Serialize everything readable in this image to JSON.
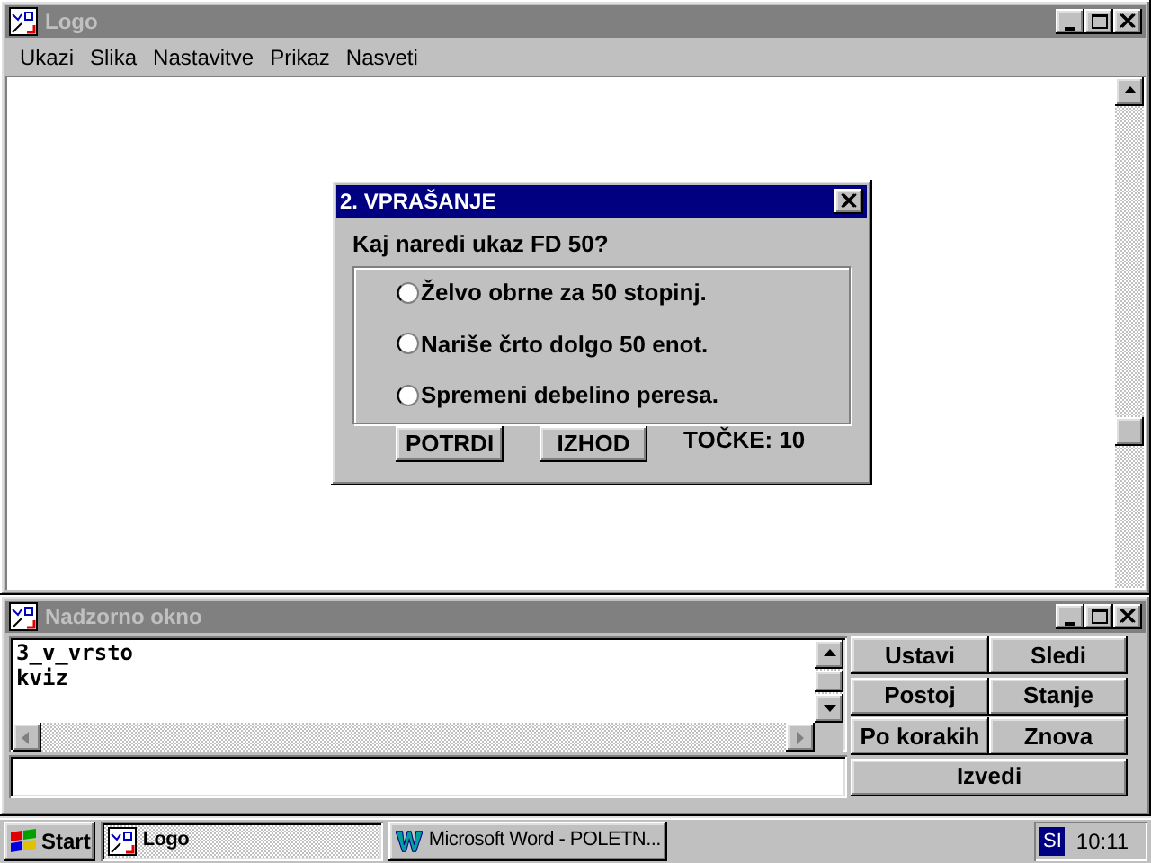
{
  "main_window": {
    "title": "Logo",
    "active": false,
    "menu": [
      "Ukazi",
      "Slika",
      "Nastavitve",
      "Prikaz",
      "Nasveti"
    ]
  },
  "dialog": {
    "title": "2. VPRAŠANJE",
    "active": true,
    "question": "Kaj naredi ukaz FD 50?",
    "options": [
      {
        "label": "Želvo obrne za 50 stopinj.",
        "selected": false
      },
      {
        "label": "Nariše črto dolgo 50 enot.",
        "selected": false
      },
      {
        "label": "Spremeni debelino peresa.",
        "selected": false
      }
    ],
    "buttons": [
      "POTRDI",
      "IZHOD"
    ],
    "score": "TOČKE: 10"
  },
  "monitor_window": {
    "title": "Nadzorno okno",
    "active": false,
    "lines": [
      "3_v_vrsto",
      "kviz"
    ],
    "buttons": [
      "Ustavi",
      "Sledi",
      "Postoj",
      "Stanje",
      "Po korakih",
      "Znova",
      "Izvedi"
    ]
  },
  "taskbar": {
    "start": "Start",
    "tasks": [
      {
        "label": "Logo",
        "kind": "logo",
        "selected": true
      },
      {
        "label": "Microsoft Word - POLETN...",
        "kind": "word",
        "selected": false
      }
    ],
    "language": "SI",
    "clock": "10:11"
  }
}
